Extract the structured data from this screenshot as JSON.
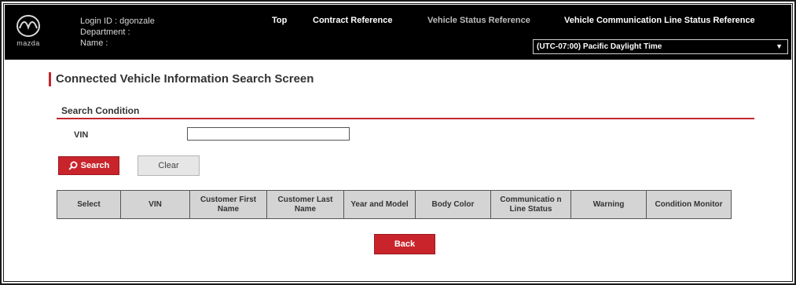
{
  "brand": {
    "logo_text": "mazda"
  },
  "user": {
    "login_label": "Login ID",
    "login_value": "dgonzale",
    "department_label": "Department",
    "name_label": "Name"
  },
  "nav": [
    {
      "label": "Top"
    },
    {
      "label": "Contract Reference"
    },
    {
      "label": "Vehicle Status Reference"
    },
    {
      "label": "Vehicle Communication Line Status Reference"
    }
  ],
  "timezone": {
    "selected": "(UTC-07:00) Pacific Daylight Time"
  },
  "page": {
    "title": "Connected Vehicle Information Search Screen"
  },
  "search": {
    "section_title": "Search Condition",
    "vin_label": "VIN",
    "vin_value": "",
    "search_label": "Search",
    "clear_label": "Clear"
  },
  "table": {
    "columns": [
      "Select",
      "VIN",
      "Customer First Name",
      "Customer Last Name",
      "Year and Model",
      "Body Color",
      "Communicatio n Line Status",
      "Warning",
      "Condition Monitor"
    ]
  },
  "footer": {
    "back_label": "Back"
  },
  "colors": {
    "accent": "#c9242b",
    "header_bg": "#000000",
    "table_header_bg": "#d4d4d4"
  },
  "icons": {
    "logo": "mazda-logo-icon",
    "search": "search-icon",
    "dropdown": "dropdown-arrow-icon"
  }
}
